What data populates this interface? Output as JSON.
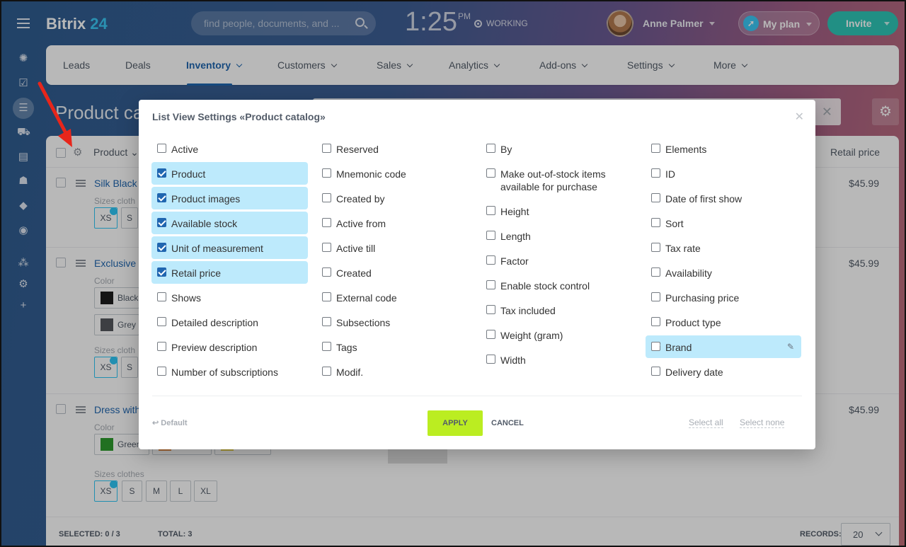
{
  "header": {
    "logo_name": "Bitrix",
    "logo_num": "24",
    "search_placeholder": "find people, documents, and ...",
    "time": "1:25",
    "ampm": "PM",
    "status": "WORKING",
    "user_name": "Anne Palmer",
    "myplan": "My plan",
    "invite": "Invite"
  },
  "nav": {
    "tabs": [
      {
        "label": "Leads"
      },
      {
        "label": "Deals"
      },
      {
        "label": "Inventory"
      },
      {
        "label": "Customers"
      },
      {
        "label": "Sales"
      },
      {
        "label": "Analytics"
      },
      {
        "label": "Add-ons"
      },
      {
        "label": "Settings"
      },
      {
        "label": "More"
      }
    ]
  },
  "page": {
    "title": "Product cat"
  },
  "grid": {
    "col_product": "Product",
    "col_price": "Retail price",
    "rows": [
      {
        "name": "Silk Black",
        "label": "Sizes cloth",
        "sizes": [
          "XS",
          "S"
        ],
        "price": "$45.99"
      },
      {
        "name": "Exclusive",
        "label1": "Color",
        "colors": [
          "Black",
          "Grey"
        ],
        "label2": "Sizes cloth",
        "sizes": [
          "XS",
          "S"
        ],
        "price": "$45.99"
      },
      {
        "name": "Dress with",
        "label1": "Color",
        "colors": [
          "Green"
        ],
        "label2": "Sizes clothes",
        "sizes": [
          "XS",
          "S",
          "M",
          "L",
          "XL"
        ],
        "price": "$45.99"
      }
    ],
    "footer": {
      "selected": "SELECTED: 0 / 3",
      "total": "TOTAL: 3",
      "records_label": "RECORDS:",
      "records_value": "20"
    }
  },
  "modal": {
    "title": "List View Settings «Product catalog»",
    "columns": [
      [
        {
          "label": "Active",
          "checked": false
        },
        {
          "label": "Product",
          "checked": true
        },
        {
          "label": "Product images",
          "checked": true
        },
        {
          "label": "Available stock",
          "checked": true
        },
        {
          "label": "Unit of measurement",
          "checked": true
        },
        {
          "label": "Retail price",
          "checked": true
        },
        {
          "label": "Shows",
          "checked": false
        },
        {
          "label": "Detailed description",
          "checked": false
        },
        {
          "label": "Preview description",
          "checked": false
        },
        {
          "label": "Number of subscriptions",
          "checked": false
        }
      ],
      [
        {
          "label": "Reserved",
          "checked": false
        },
        {
          "label": "Mnemonic code",
          "checked": false
        },
        {
          "label": "Created by",
          "checked": false
        },
        {
          "label": "Active from",
          "checked": false
        },
        {
          "label": "Active till",
          "checked": false
        },
        {
          "label": "Created",
          "checked": false
        },
        {
          "label": "External code",
          "checked": false
        },
        {
          "label": "Subsections",
          "checked": false
        },
        {
          "label": "Tags",
          "checked": false
        },
        {
          "label": "Modif.",
          "checked": false
        }
      ],
      [
        {
          "label": "By",
          "checked": false
        },
        {
          "label": "Make out-of-stock items\navailable for purchase",
          "checked": false
        },
        {
          "label": "Height",
          "checked": false
        },
        {
          "label": "Length",
          "checked": false
        },
        {
          "label": "Factor",
          "checked": false
        },
        {
          "label": "Enable stock control",
          "checked": false
        },
        {
          "label": "Tax included",
          "checked": false
        },
        {
          "label": "Weight (gram)",
          "checked": false
        },
        {
          "label": "Width",
          "checked": false
        }
      ],
      [
        {
          "label": "Elements",
          "checked": false
        },
        {
          "label": "ID",
          "checked": false
        },
        {
          "label": "Date of first show",
          "checked": false
        },
        {
          "label": "Sort",
          "checked": false
        },
        {
          "label": "Tax rate",
          "checked": false
        },
        {
          "label": "Availability",
          "checked": false
        },
        {
          "label": "Purchasing price",
          "checked": false
        },
        {
          "label": "Product type",
          "checked": false
        },
        {
          "label": "Brand",
          "checked": false,
          "hover": true
        },
        {
          "label": "Delivery date",
          "checked": false
        }
      ]
    ],
    "default_label": "Default",
    "apply_label": "APPLY",
    "cancel_label": "CANCEL",
    "select_all": "Select all",
    "select_none": "Select none"
  },
  "colors": {
    "accent": "#2067b0",
    "apply": "#bbed21",
    "checked_bg": "#bdeafc",
    "arrow": "#e8261b"
  }
}
